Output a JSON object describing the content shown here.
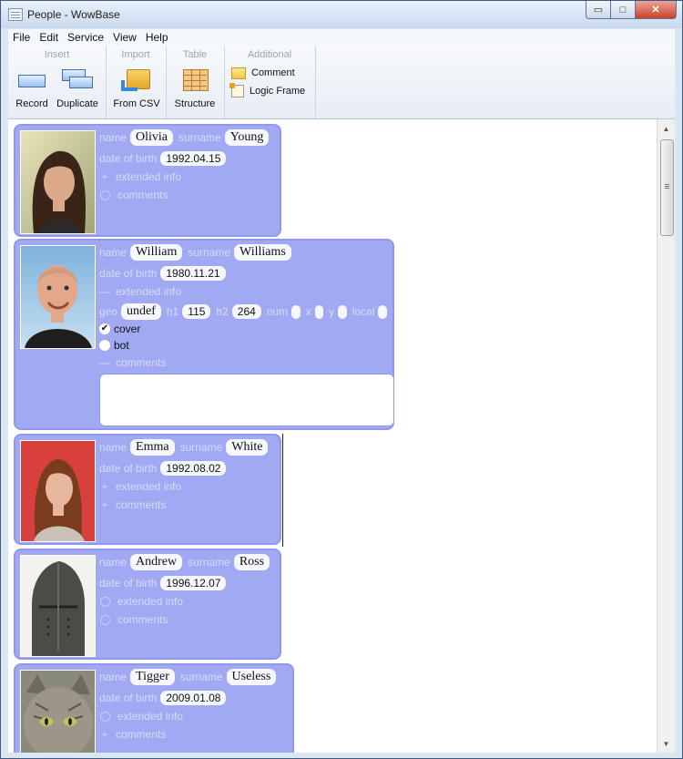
{
  "window": {
    "title": "People - WowBase",
    "controls": {
      "minimize": "▭",
      "maximize": "□",
      "close": "✕"
    }
  },
  "menu": [
    "File",
    "Edit",
    "Service",
    "View",
    "Help"
  ],
  "ribbon": {
    "insert": {
      "label": "Insert",
      "record": "Record",
      "duplicate": "Duplicate"
    },
    "import": {
      "label": "Import",
      "from_csv": "From CSV"
    },
    "table": {
      "label": "Table",
      "structure": "Structure"
    },
    "additional": {
      "label": "Additional",
      "comment": "Comment",
      "logic_frame": "Logic Frame"
    }
  },
  "labels": {
    "name": "name",
    "surname": "surname",
    "date_of_birth": "date of birth",
    "extended_info": "extended info",
    "comments": "comments",
    "geo": "geo",
    "h1": "h1",
    "h2": "h2",
    "num": "num",
    "x": "x",
    "y": "y",
    "local": "local",
    "cover": "cover",
    "bot": "bot"
  },
  "records": [
    {
      "name": "Olivia",
      "surname": "Young",
      "date_of_birth": "1992.04.15",
      "extended": "+",
      "comments": "empty"
    },
    {
      "name": "William",
      "surname": "Williams",
      "date_of_birth": "1980.11.21",
      "extended": "—",
      "comments": "—",
      "geo": "undef",
      "h1": "115",
      "h2": "264",
      "cover": true,
      "bot": false
    },
    {
      "name": "Emma",
      "surname": "White",
      "date_of_birth": "1992.08.02",
      "extended": "+",
      "comments": "+"
    },
    {
      "name": "Andrew",
      "surname": "Ross",
      "date_of_birth": "1996.12.07",
      "extended": "empty",
      "comments": "empty"
    },
    {
      "name": "Tigger",
      "surname": "Useless",
      "date_of_birth": "2009.01.08",
      "extended": "empty",
      "comments": "+"
    }
  ],
  "colors": {
    "card": "#a1a9f2",
    "card_border": "#8f98ee",
    "field_bg": "#f7f7ff"
  }
}
